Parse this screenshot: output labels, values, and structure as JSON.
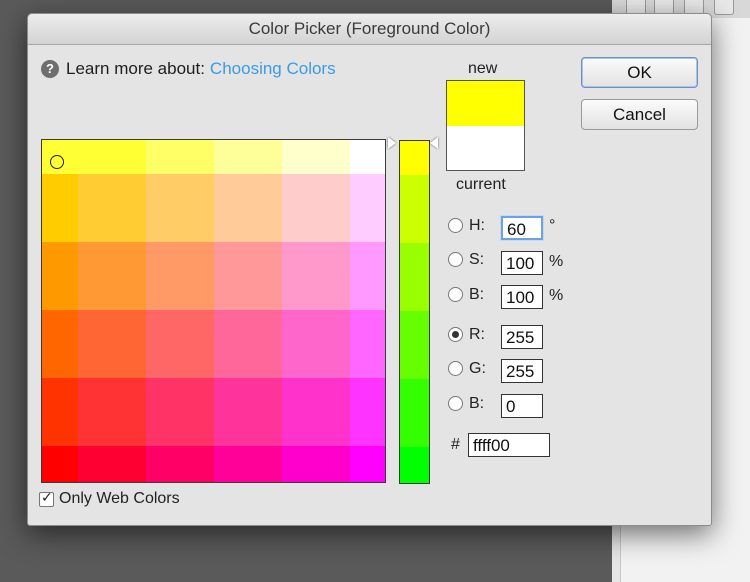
{
  "dialog": {
    "title": "Color Picker (Foreground Color)"
  },
  "help": {
    "prefix": "Learn more about:",
    "link": "Choosing Colors",
    "icon": "help-icon"
  },
  "preview": {
    "new_label": "new",
    "current_label": "current",
    "new_color": "#ffff00",
    "current_color": "#ffffff"
  },
  "buttons": {
    "ok": "OK",
    "cancel": "Cancel"
  },
  "fields": {
    "h": {
      "label": "H:",
      "value": "60",
      "unit": "°"
    },
    "s": {
      "label": "S:",
      "value": "100",
      "unit": "%"
    },
    "b": {
      "label": "B:",
      "value": "100",
      "unit": "%"
    },
    "r": {
      "label": "R:",
      "value": "255",
      "selected": true
    },
    "g": {
      "label": "G:",
      "value": "255"
    },
    "bl": {
      "label": "B:",
      "value": "0"
    },
    "hex": {
      "label": "#",
      "value": "ffff00"
    }
  },
  "web_colors": {
    "label": "Only Web Colors",
    "checked": true
  },
  "color_field": {
    "rows": [
      [
        "#ffff33",
        "#ffff33",
        "#ffff66",
        "#ffff99",
        "#ffffcc",
        "#ffffff"
      ],
      [
        "#ffcc00",
        "#ffcc33",
        "#ffcc66",
        "#ffcc99",
        "#ffcccc",
        "#ffccff"
      ],
      [
        "#ff9900",
        "#ff9933",
        "#ff9966",
        "#ff9999",
        "#ff99cc",
        "#ff99ff"
      ],
      [
        "#ff6600",
        "#ff6633",
        "#ff6666",
        "#ff6699",
        "#ff66cc",
        "#ff66ff"
      ],
      [
        "#ff3300",
        "#ff3333",
        "#ff3366",
        "#ff3399",
        "#ff33cc",
        "#ff33ff"
      ],
      [
        "#ff0000",
        "#ff0033",
        "#ff0066",
        "#ff0099",
        "#ff00cc",
        "#ff00ff"
      ]
    ],
    "strip": [
      "#ffff00",
      "#ccff00",
      "#99ff00",
      "#66ff00",
      "#33ff00",
      "#00ff00"
    ]
  }
}
